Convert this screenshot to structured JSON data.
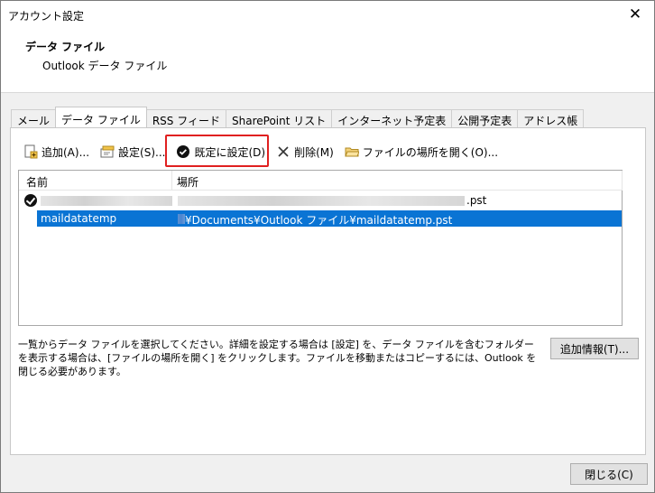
{
  "window": {
    "title": "アカウント設定"
  },
  "header": {
    "title": "データ ファイル",
    "subtitle": "Outlook データ ファイル"
  },
  "tabs": [
    {
      "label": "メール"
    },
    {
      "label": "データ ファイル"
    },
    {
      "label": "RSS フィード"
    },
    {
      "label": "SharePoint リスト"
    },
    {
      "label": "インターネット予定表"
    },
    {
      "label": "公開予定表"
    },
    {
      "label": "アドレス帳"
    }
  ],
  "toolbar": {
    "add": "追加(A)...",
    "settings": "設定(S)...",
    "set_default": "既定に設定(D)",
    "delete": "削除(M)",
    "open_location": "ファイルの場所を開く(O)..."
  },
  "list": {
    "columns": {
      "name": "名前",
      "location": "場所"
    },
    "rows": [
      {
        "name": "",
        "location_suffix": ".pst"
      },
      {
        "name": "maildatatemp",
        "location": "¥Documents¥Outlook ファイル¥maildatatemp.pst"
      }
    ]
  },
  "description": "一覧からデータ ファイルを選択してください。詳細を設定する場合は [設定] を、データ ファイルを含むフォルダーを表示する場合は、[ファイルの場所を開く] をクリックします。ファイルを移動またはコピーするには、Outlook を閉じる必要があります。",
  "buttons": {
    "more_info": "追加情報(T)...",
    "close": "閉じる(C)"
  },
  "colors": {
    "accent": "#0a74d4",
    "highlight": "#e02020"
  }
}
